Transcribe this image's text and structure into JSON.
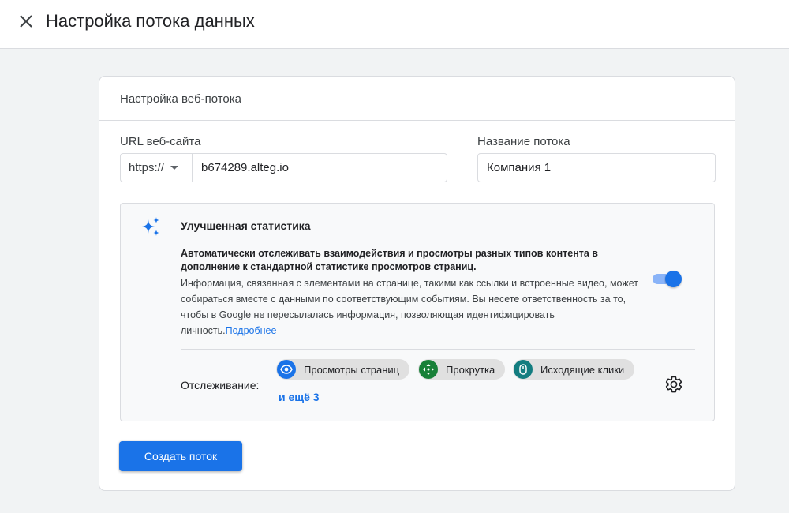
{
  "page": {
    "title": "Настройка потока данных"
  },
  "card": {
    "title": "Настройка веб-потока"
  },
  "form": {
    "url_label": "URL веб-сайта",
    "protocol": "https://",
    "url_value": "b674289.alteg.io",
    "name_label": "Название потока",
    "name_value": "Компания 1"
  },
  "enhanced": {
    "title": "Улучшенная статистика",
    "description_bold": "Автоматически отслеживать взаимодействия и просмотры разных типов контента в дополнение к стандартной статистике просмотров страниц.",
    "description": "Информация, связанная с элементами на странице, такими как ссылки и встроенные видео, может собираться вместе с данными по соответствующим событиям. Вы несете ответственность за то, чтобы в Google не пересылалась информация, позволяющая идентифицировать личность.",
    "learn_more": "Подробнее",
    "toggle_on": true,
    "tracking_label": "Отслеживание:",
    "chips": [
      {
        "label": "Просмотры страниц",
        "icon": "eye-icon",
        "color": "#1a73e8"
      },
      {
        "label": "Прокрутка",
        "icon": "scroll-arrows-icon",
        "color": "#188038"
      },
      {
        "label": "Исходящие клики",
        "icon": "mouse-icon",
        "color": "#137d80"
      }
    ],
    "more": "и ещё 3"
  },
  "actions": {
    "create_label": "Создать поток"
  },
  "colors": {
    "accent": "#1a73e8",
    "toggle_track": "#8ab4f8"
  }
}
